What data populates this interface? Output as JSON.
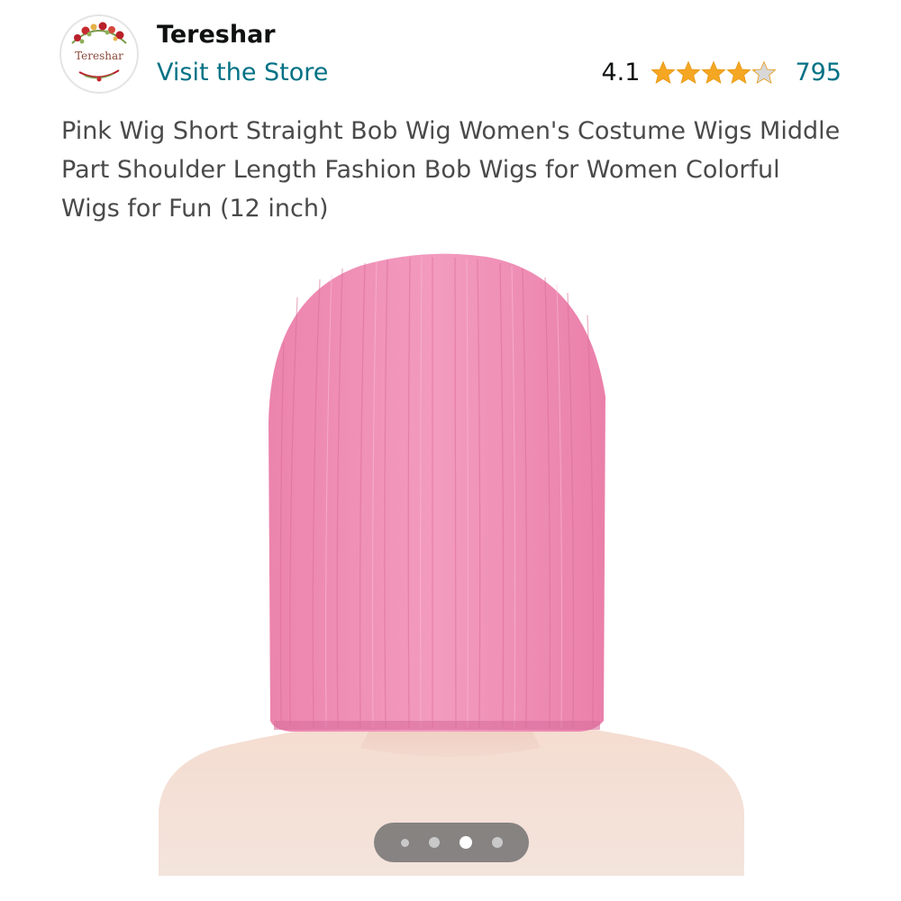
{
  "store": {
    "name": "Tereshar",
    "logo_text": "Tereshar",
    "visit_label": "Visit the Store"
  },
  "rating": {
    "value": "4.1",
    "stars_filled": 4.1,
    "stars_total": 5,
    "count": "795",
    "star_color": "#f5a623",
    "star_empty_color": "#d8d8d8"
  },
  "product": {
    "title": "Pink Wig Short Straight Bob Wig Women's Costume Wigs Middle Part Shoulder Length Fashion Bob Wigs for Women Colorful Wigs for Fun (12 inch)",
    "image_icon": "pink-bob-wig-photo",
    "wig_color": "#f08db5"
  },
  "carousel": {
    "total": 4,
    "active_index": 2
  },
  "colors": {
    "link": "#007185",
    "text": "#0f1111",
    "title_text": "#4a4a4a"
  }
}
